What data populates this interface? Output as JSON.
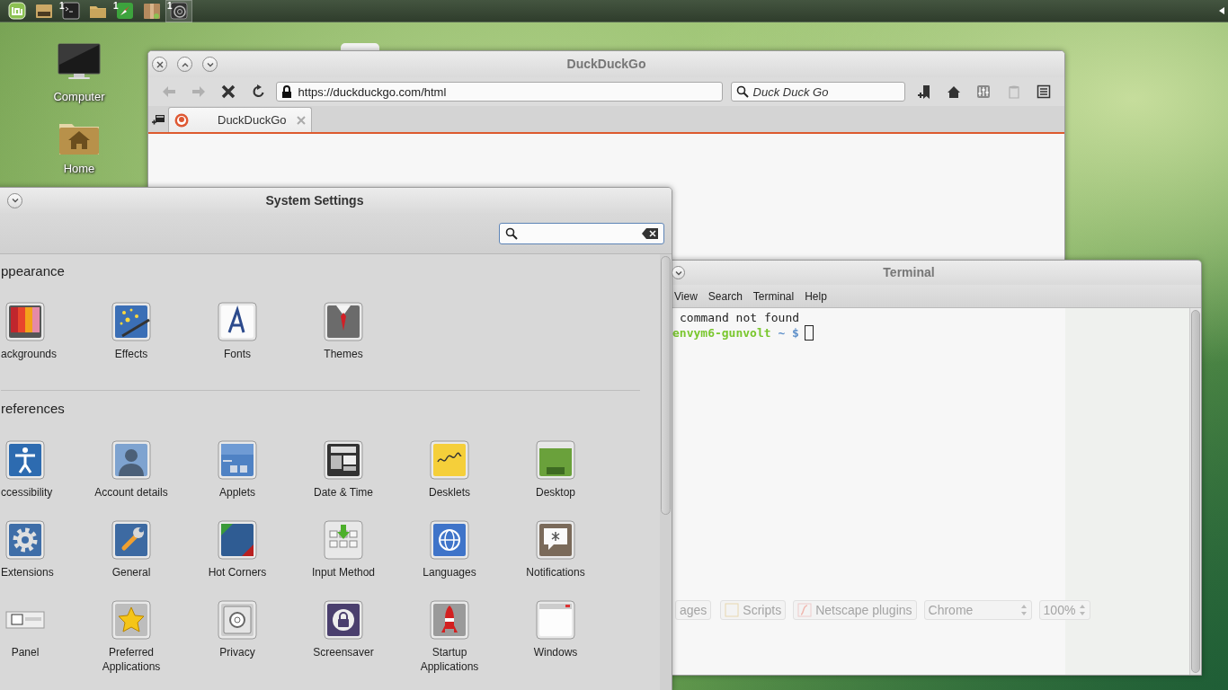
{
  "panel": {
    "launchers": [
      {
        "selected": false
      },
      {
        "selected": false
      },
      {
        "selected": false,
        "badge": "1"
      },
      {
        "selected": false
      },
      {
        "selected": false,
        "badge": "1"
      },
      {
        "selected": false
      },
      {
        "selected": true,
        "badge": "1"
      }
    ]
  },
  "desktop_icons": [
    {
      "label": "Computer"
    },
    {
      "label": "Home"
    }
  ],
  "browser": {
    "title": "DuckDuckGo",
    "back": {
      "disabled": true
    },
    "forward": {
      "disabled": true
    },
    "url": "https://duckduckgo.com/html",
    "search": {
      "placeholder": "Duck Duck Go"
    },
    "trash": {
      "disabled": true
    },
    "tabs": [
      {
        "label": "DuckDuckGo",
        "selected": true
      }
    ],
    "status_bar": [
      {
        "kind": "button",
        "label": "ages"
      },
      {
        "kind": "button",
        "label": "Scripts"
      },
      {
        "kind": "button",
        "label": "Netscape plugins"
      },
      {
        "kind": "select",
        "label": "Chrome"
      },
      {
        "kind": "spin",
        "label": "100%"
      }
    ]
  },
  "terminal": {
    "title": "Terminal",
    "menu": [
      "View",
      "Search",
      "Terminal",
      "Help"
    ],
    "output": "command not found",
    "prompt": {
      "host": "envym6-gunvolt",
      "path": "~",
      "symbol": "$"
    }
  },
  "settings": {
    "title": "System Settings",
    "sections": [
      {
        "title": "ppearance",
        "items": [
          {
            "label": "ackgrounds"
          },
          {
            "label": "Effects"
          },
          {
            "label": "Fonts"
          },
          {
            "label": "Themes"
          }
        ]
      },
      {
        "title": "references",
        "items": [
          {
            "label": "ccessibility"
          },
          {
            "label": "Account details"
          },
          {
            "label": "Applets"
          },
          {
            "label": "Date & Time"
          },
          {
            "label": "Desklets"
          },
          {
            "label": "Desktop"
          },
          {
            "label": "Extensions"
          },
          {
            "label": "General"
          },
          {
            "label": "Hot Corners"
          },
          {
            "label": "Input Method"
          },
          {
            "label": "Languages"
          },
          {
            "label": "Notifications"
          },
          {
            "label": "Panel"
          },
          {
            "label": "Preferred Applications"
          },
          {
            "label": "Privacy"
          },
          {
            "label": "Screensaver"
          },
          {
            "label": "Startup Applications"
          },
          {
            "label": "Windows"
          }
        ]
      }
    ]
  }
}
